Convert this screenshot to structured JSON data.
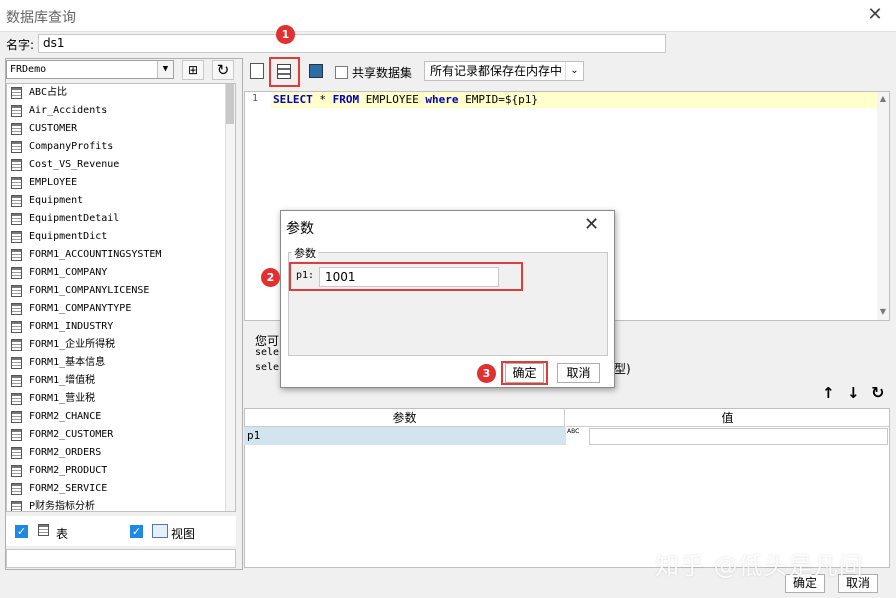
{
  "window": {
    "title": "数据库查询"
  },
  "name_field": {
    "label": "名字:",
    "value": "ds1"
  },
  "connection": {
    "value": "FRDemo"
  },
  "tables": [
    "ABC占比",
    "Air_Accidents",
    "CUSTOMER",
    "CompanyProfits",
    "Cost_VS_Revenue",
    "EMPLOYEE",
    "Equipment",
    "EquipmentDetail",
    "EquipmentDict",
    "FORM1_ACCOUNTINGSYSTEM",
    "FORM1_COMPANY",
    "FORM1_COMPANYLICENSE",
    "FORM1_COMPANYTYPE",
    "FORM1_INDUSTRY",
    "FORM1_企业所得税",
    "FORM1_基本信息",
    "FORM1_增值税",
    "FORM1_营业税",
    "FORM2_CHANCE",
    "FORM2_CUSTOMER",
    "FORM2_ORDERS",
    "FORM2_PRODUCT",
    "FORM2_SERVICE",
    "P财务指标分析"
  ],
  "filters": {
    "table_label": "表",
    "view_label": "视图"
  },
  "toolbar": {
    "share_label": "共享数据集",
    "storage_value": "所有记录都保存在内存中"
  },
  "editor": {
    "line_number": "1",
    "sql_select": "SELECT",
    "sql_star": " * ",
    "sql_from": "FROM",
    "sql_table": " EMPLOYEE ",
    "sql_where": "where",
    "sql_cond": " EMPID=${p1}"
  },
  "hint": {
    "line1": "您可",
    "line2": "sele",
    "line3": "sele",
    "suffix": "型)"
  },
  "param_table": {
    "col_param": "参数",
    "col_value": "值",
    "row_name": "p1",
    "type_badge": "ABC"
  },
  "dialog": {
    "title": "参数",
    "group_label": "参数",
    "param_label": "p1:",
    "param_value": "1001",
    "ok": "确定",
    "cancel": "取消"
  },
  "badges": [
    "1",
    "2",
    "3"
  ],
  "footer": {
    "ok": "确定",
    "cancel": "取消"
  },
  "watermark": "知乎 @低头是凡间",
  "colors": {
    "keyword": "#0000c0",
    "highlight_line": "#ffffcc",
    "callout_red": "#e03c3c",
    "checkbox_blue": "#1e88e5"
  }
}
